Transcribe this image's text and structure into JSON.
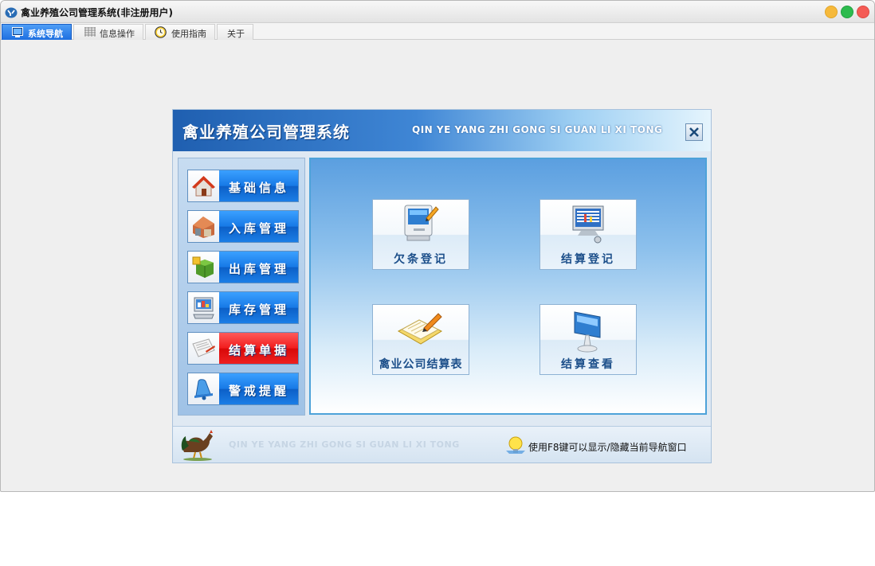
{
  "window": {
    "title": "禽业养殖公司管理系统(非注册用户)"
  },
  "tabs": [
    {
      "label": "系统导航",
      "icon": "monitor-icon",
      "active": true
    },
    {
      "label": "信息操作",
      "icon": "grid-icon",
      "active": false
    },
    {
      "label": "使用指南",
      "icon": "clock-icon",
      "active": false
    },
    {
      "label": "关于",
      "icon": "",
      "active": false
    }
  ],
  "panel": {
    "title": "禽业养殖公司管理系统",
    "subtitle": "QIN YE YANG ZHI GONG SI GUAN LI XI TONG",
    "close_icon": "close-icon"
  },
  "sidebar": {
    "items": [
      {
        "label": "基础信息",
        "icon": "house-icon"
      },
      {
        "label": "入库管理",
        "icon": "warehouse-icon"
      },
      {
        "label": "出库管理",
        "icon": "box-icon"
      },
      {
        "label": "库存管理",
        "icon": "computer-icon"
      },
      {
        "label": "结算单据",
        "icon": "document-icon",
        "active": true
      },
      {
        "label": "警戒提醒",
        "icon": "bell-icon"
      }
    ]
  },
  "functions": [
    {
      "label": "欠条登记",
      "icon": "mac-computer-icon"
    },
    {
      "label": "结算登记",
      "icon": "monitor-chart-icon"
    },
    {
      "label": "禽业公司结算表",
      "icon": "notebook-pencil-icon"
    },
    {
      "label": "结算查看",
      "icon": "flat-monitor-icon"
    }
  ],
  "footer": {
    "watermark": "QIN YE YANG ZHI GONG SI GUAN LI XI TONG",
    "hint": "使用F8键可以显示/隐藏当前导航窗口",
    "hint_icon": "lightbulb-icon",
    "logo_icon": "rooster-icon"
  },
  "colors": {
    "accent_blue": "#1779e6",
    "active_red": "#f11c1c",
    "header_blue": "#1f5fb0"
  }
}
